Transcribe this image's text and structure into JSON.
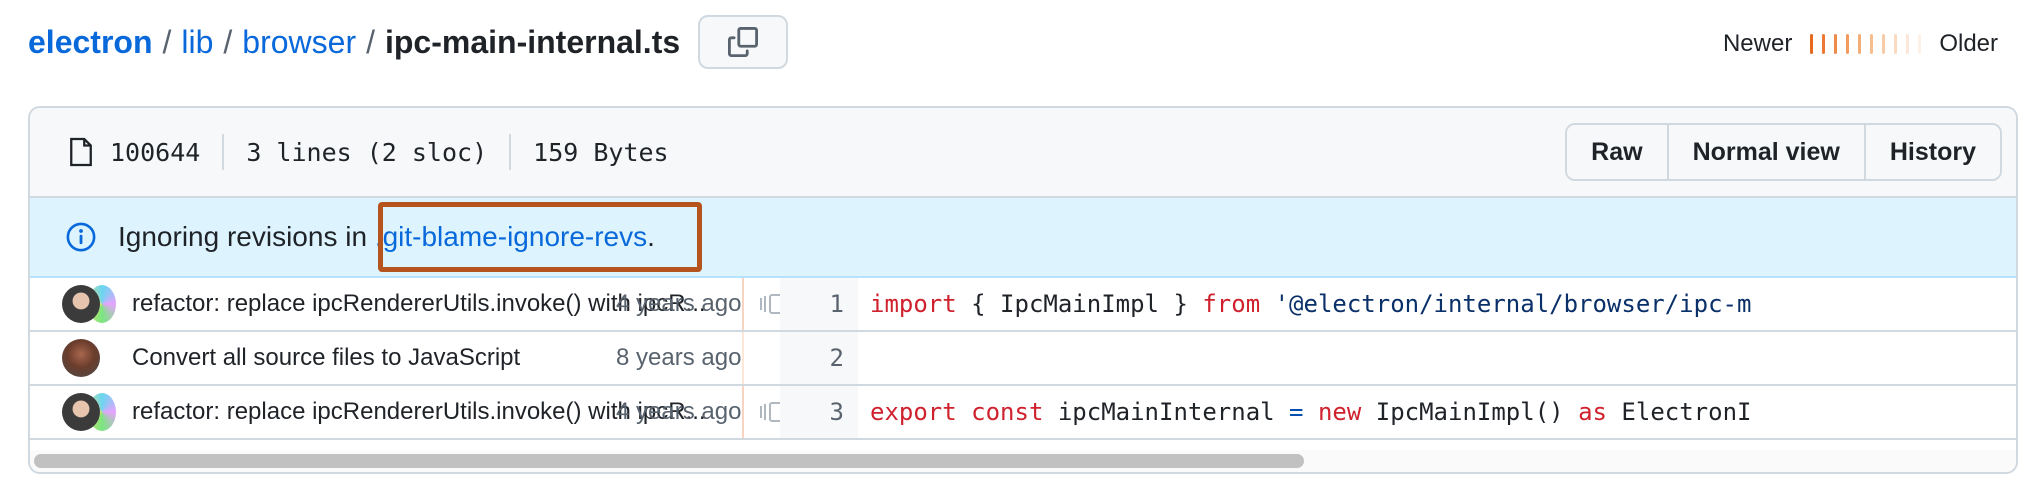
{
  "breadcrumb": {
    "repo": "electron",
    "dir1": "lib",
    "dir2": "browser",
    "file": "ipc-main-internal.ts",
    "sep": "/"
  },
  "age_legend": {
    "newer": "Newer",
    "older": "Older",
    "bar_colors": [
      "#e8681c",
      "#ec7a34",
      "#ef8b48",
      "#f19c5e",
      "#f4ad76",
      "#f6bd8f",
      "#f8cca8",
      "#fadac0",
      "#fce7d8",
      "#fdf0e6"
    ]
  },
  "file_header": {
    "mode": "100644",
    "lines": "3 lines (2 sloc)",
    "size": "159 Bytes",
    "buttons": {
      "raw": "Raw",
      "normal_view": "Normal view",
      "history": "History"
    }
  },
  "flash": {
    "text_before": "Ignoring revisions in ",
    "link": ".git-blame-ignore-revs",
    "text_after": "."
  },
  "blame": [
    {
      "message": "refactor: replace ipcRendererUtils.invoke() with ipcR...",
      "when": "4 years ago",
      "line": "1",
      "code": [
        {
          "t": "import",
          "c": "kw"
        },
        {
          "t": " { IpcMainImpl } ",
          "c": ""
        },
        {
          "t": "from",
          "c": "kw"
        },
        {
          "t": " ",
          "c": ""
        },
        {
          "t": "'@electron/internal/browser/ipc-m",
          "c": "str"
        }
      ]
    },
    {
      "message": "Convert all source files to JavaScript",
      "when": "8 years ago",
      "line": "2",
      "code": []
    },
    {
      "message": "refactor: replace ipcRendererUtils.invoke() with ipcR...",
      "when": "4 years ago",
      "line": "3",
      "code": [
        {
          "t": "export",
          "c": "kw"
        },
        {
          "t": " ",
          "c": ""
        },
        {
          "t": "const",
          "c": "kw"
        },
        {
          "t": " ipcMainInternal ",
          "c": ""
        },
        {
          "t": "=",
          "c": "op"
        },
        {
          "t": " ",
          "c": ""
        },
        {
          "t": "new",
          "c": "kw"
        },
        {
          "t": " IpcMainImpl() ",
          "c": ""
        },
        {
          "t": "as",
          "c": "kw"
        },
        {
          "t": " ElectronI",
          "c": ""
        }
      ]
    }
  ],
  "colors": {
    "link": "#0969da",
    "keyword": "#cf222e",
    "string": "#0a3069",
    "highlight_border": "#b5541f",
    "flash_bg": "#ddf4ff"
  },
  "icons": [
    "copy-icon",
    "file-icon",
    "info-icon",
    "reblame-icon"
  ]
}
